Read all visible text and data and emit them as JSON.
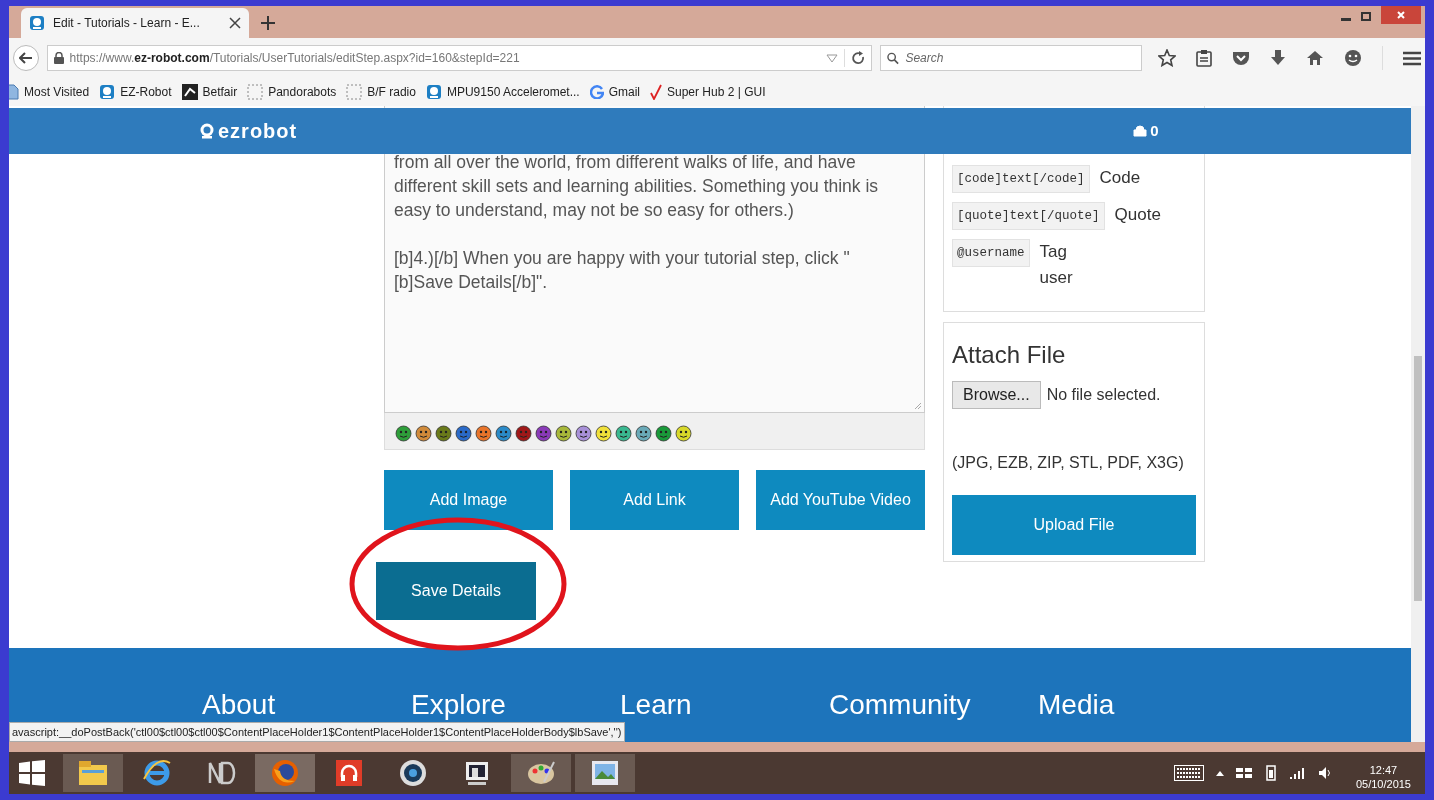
{
  "browser": {
    "tab_title": "Edit - Tutorials - Learn - E...",
    "url": "https://www.**ez-robot.com**/Tutorials/UserTutorials/editStep.aspx?id=160&stepId=221",
    "search": {
      "placeholder": "Search"
    },
    "bookmarks": [
      {
        "label": "Most Visited",
        "kind": "page"
      },
      {
        "label": "EZ-Robot",
        "kind": "robot"
      },
      {
        "label": "Betfair",
        "kind": "dark"
      },
      {
        "label": "Pandorabots",
        "kind": "dashed"
      },
      {
        "label": "B/F radio",
        "kind": "dashed"
      },
      {
        "label": "MPU9150 Acceleromet...",
        "kind": "robot"
      },
      {
        "label": "Gmail",
        "kind": "g"
      },
      {
        "label": "Super Hub 2 | GUI",
        "kind": "check"
      }
    ]
  },
  "site_header": {
    "logo": "ezrobot",
    "cart_count": "0"
  },
  "editor": {
    "paragraphs": [
      "from all over the world,  from different walks of life, and have different skill sets and learning abilities. Something you think is easy to understand, may not be so easy for others.)",
      "[b]4.)[/b] When you are happy with your tutorial step, click \"[b]Save Details[/b]\"."
    ],
    "buttons": [
      "Add Image",
      "Add Link",
      "Add YouTube Video"
    ],
    "save_button": "Save Details"
  },
  "formatting": [
    {
      "code": "[code]text[/code]",
      "label": "Code"
    },
    {
      "code": "[quote]text[/quote]",
      "label": "Quote"
    },
    {
      "code": "@username",
      "label": "Tag user"
    }
  ],
  "attach_file": {
    "title": "Attach File",
    "browse_button": "Browse...",
    "file_status": "No file selected.",
    "allowed_types": "(JPG, EZB, ZIP, STL, PDF, X3G)",
    "upload_button": "Upload File"
  },
  "footer": {
    "headings": [
      "About",
      "Explore",
      "Learn",
      "Community",
      "Media"
    ]
  },
  "status_link": "avascript:__doPostBack('ctl00$ctl00$ctl00$ContentPlaceHolder1$ContentPlaceHolder1$ContentPlaceHolderBody$lbSave','')",
  "taskbar": {
    "time": "12:47",
    "date": "05/10/2015"
  }
}
